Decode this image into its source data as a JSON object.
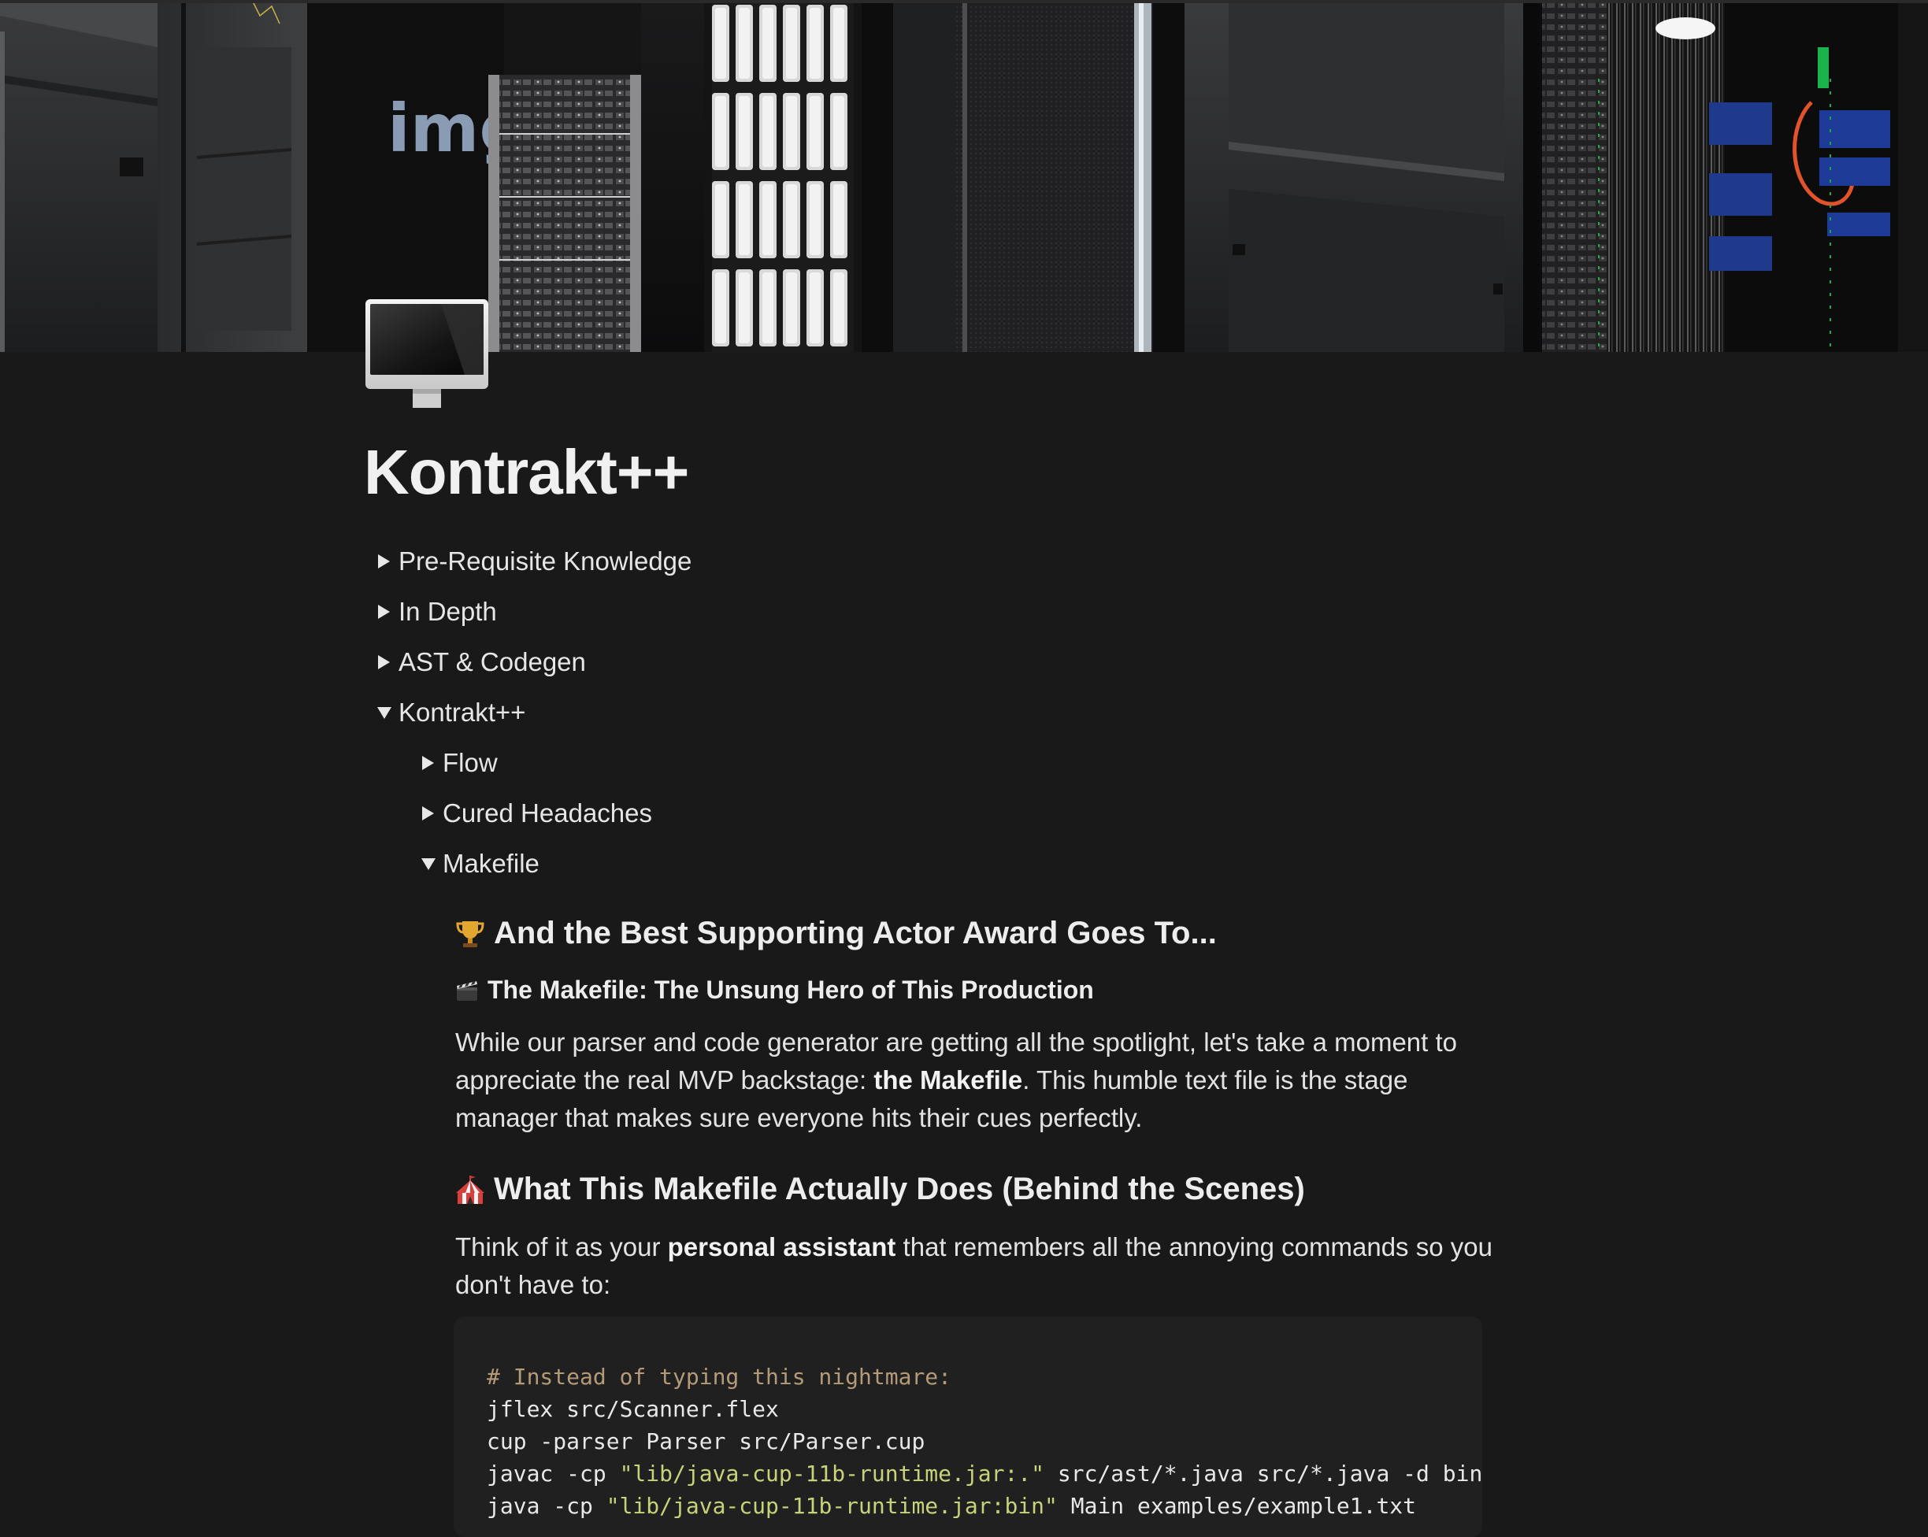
{
  "cover": {
    "rack_brand": "img"
  },
  "page": {
    "icon": "desktop-computer-icon",
    "title": "Kontrakt++"
  },
  "toggles": [
    {
      "label": "Pre-Requisite Knowledge",
      "expanded": false,
      "level": 0
    },
    {
      "label": "In Depth",
      "expanded": false,
      "level": 0
    },
    {
      "label": "AST & Codegen",
      "expanded": false,
      "level": 0
    },
    {
      "label": "Kontrakt++",
      "expanded": true,
      "level": 0
    },
    {
      "label": "Flow",
      "expanded": false,
      "level": 1
    },
    {
      "label": "Cured Headaches",
      "expanded": false,
      "level": 1
    },
    {
      "label": "Makefile",
      "expanded": true,
      "level": 1
    }
  ],
  "makefile_section": {
    "heading_1": {
      "icon": "trophy-icon",
      "text": "And the Best Supporting Actor Award Goes To..."
    },
    "heading_2": {
      "icon": "clapper-board-icon",
      "text": "The Makefile: The Unsung Hero of This Production"
    },
    "para_1": {
      "before": "While our parser and code generator are getting all the spotlight, let's take a moment to appreciate the real MVP backstage: ",
      "bold": "the Makefile",
      "after": ". This humble text file is the stage manager that makes sure everyone hits their cues perfectly."
    },
    "heading_3": {
      "icon": "circus-tent-icon",
      "text": "What This Makefile Actually Does (Behind the Scenes)"
    },
    "para_2": {
      "before": "Think of it as your ",
      "bold": "personal assistant",
      "after": " that remembers all the annoying commands so you don't have to:"
    },
    "code": {
      "comment": "# Instead of typing this nightmare:",
      "line_2": "jflex src/Scanner.flex",
      "line_3": "cup -parser Parser src/Parser.cup",
      "line_4_cmd": "javac -cp ",
      "line_4_str": "\"lib/java-cup-11b-runtime.jar:.\"",
      "line_4_rest": " src/ast/*.java src/*.java -d bin",
      "line_5_cmd": "java -cp ",
      "line_5_str": "\"lib/java-cup-11b-runtime.jar:bin\"",
      "line_5_rest": " Main examples/example1.txt"
    }
  },
  "colors": {
    "background": "#191919",
    "code_background": "#202020",
    "code_comment": "#b59a78",
    "code_string": "#c7d27a",
    "text": "#e6e6e6"
  }
}
